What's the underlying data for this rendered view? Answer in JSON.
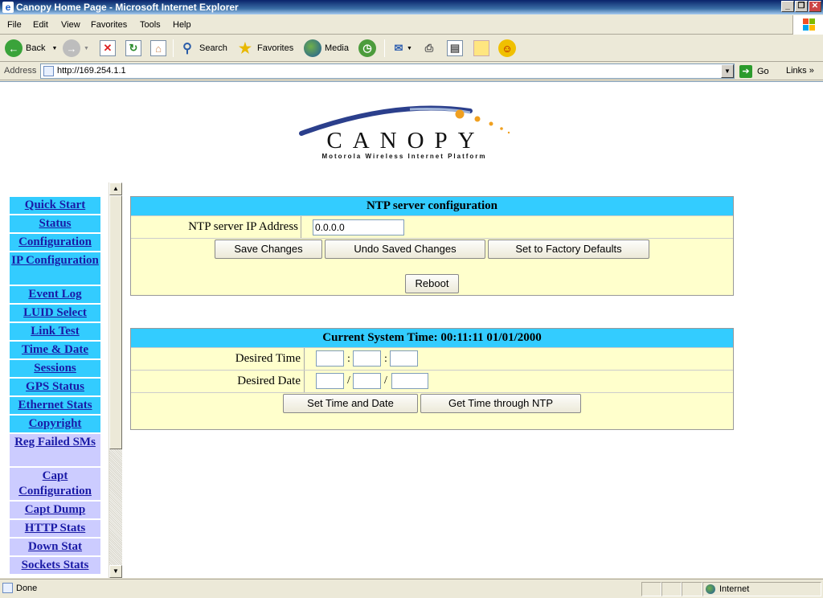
{
  "window": {
    "title": "Canopy Home Page - Microsoft Internet Explorer",
    "minimize": "_",
    "restore": "❐",
    "close": "✕"
  },
  "menu": [
    "File",
    "Edit",
    "View",
    "Favorites",
    "Tools",
    "Help"
  ],
  "toolbar": {
    "back": "Back",
    "search": "Search",
    "favorites": "Favorites",
    "media": "Media"
  },
  "address": {
    "label": "Address",
    "url": "http://169.254.1.1",
    "go": "Go",
    "links": "Links"
  },
  "logo": {
    "brand": "CANOPY",
    "tagline": "Motorola Wireless Internet Platform"
  },
  "sidebar": {
    "items": [
      {
        "label": "Quick Start",
        "style": "blue"
      },
      {
        "label": "Status",
        "style": "blue"
      },
      {
        "label": "Configuration",
        "style": "blue"
      },
      {
        "label": "IP Configuration",
        "style": "blue"
      },
      {
        "label": "Event Log",
        "style": "blue"
      },
      {
        "label": "LUID Select",
        "style": "blue"
      },
      {
        "label": "Link Test",
        "style": "blue"
      },
      {
        "label": "Time & Date",
        "style": "blue"
      },
      {
        "label": "Sessions",
        "style": "blue"
      },
      {
        "label": "GPS Status",
        "style": "blue"
      },
      {
        "label": "Ethernet Stats",
        "style": "blue"
      },
      {
        "label": "Copyright",
        "style": "blue"
      },
      {
        "label": "Reg Failed SMs",
        "style": "lav"
      },
      {
        "label": "Capt Configuration",
        "style": "lav"
      },
      {
        "label": "Capt Dump",
        "style": "lav"
      },
      {
        "label": "HTTP Stats",
        "style": "lav"
      },
      {
        "label": "Down Stat",
        "style": "lav"
      },
      {
        "label": "Sockets Stats",
        "style": "lav"
      }
    ]
  },
  "ntp_panel": {
    "title": "NTP server configuration",
    "ip_label": "NTP server IP Address",
    "ip_value": "0.0.0.0",
    "save": "Save Changes",
    "undo": "Undo Saved Changes",
    "factory": "Set to Factory Defaults",
    "reboot": "Reboot"
  },
  "time_panel": {
    "title": "Current System Time: 00:11:11 01/01/2000",
    "time_label": "Desired Time",
    "date_label": "Desired Date",
    "time_sep": ":",
    "date_sep": "/",
    "set": "Set Time and Date",
    "ntp": "Get Time through NTP"
  },
  "status": {
    "text": "Done",
    "zone": "Internet"
  },
  "colors": {
    "nav_blue": "#33ccff",
    "nav_lavender": "#ccccff",
    "panel_bg": "#ffffcc",
    "link": "#1a1aa6"
  }
}
